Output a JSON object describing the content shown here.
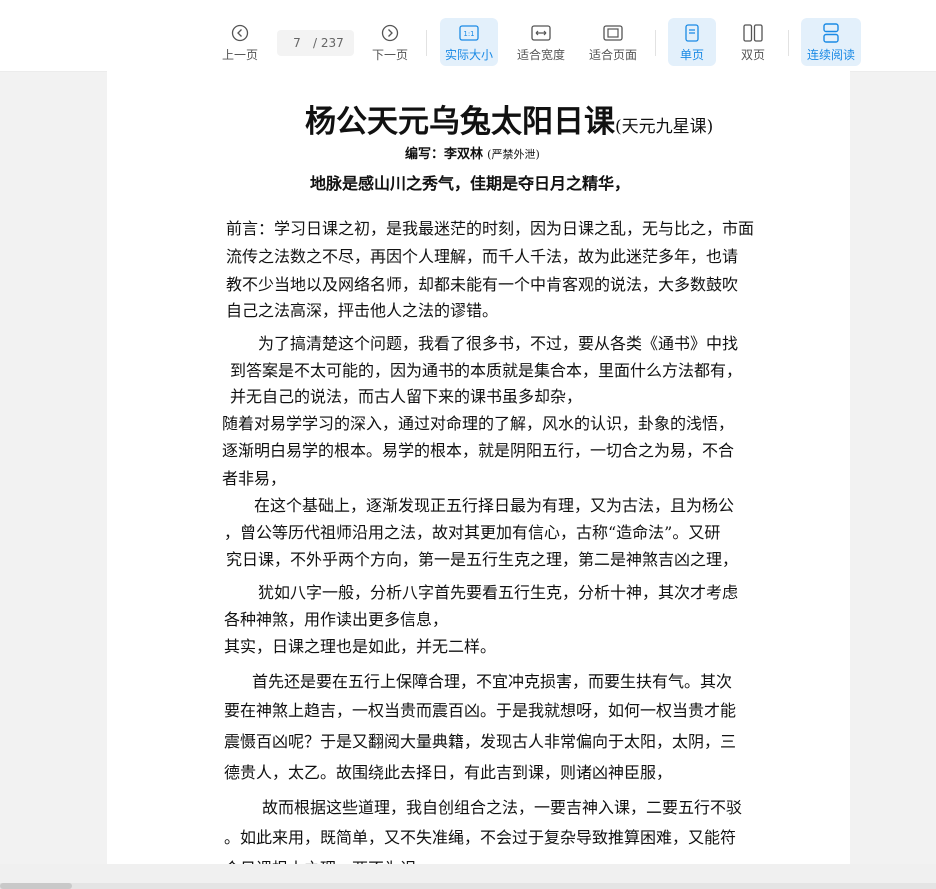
{
  "toolbar": {
    "prev_label": "上一页",
    "current_page": "7",
    "total_pages": "/ 237",
    "next_label": "下一页",
    "actual_size_label": "实际大小",
    "fit_width_label": "适合宽度",
    "fit_page_label": "适合页面",
    "single_page_label": "单页",
    "double_page_label": "双页",
    "continuous_label": "连续阅读",
    "actual_size_icon_text": "1:1",
    "accent_color": "#1a8ae5"
  },
  "document": {
    "title": "杨公天元乌兔太阳日课",
    "title_sub": "(天元九星课)",
    "author_prefix": "编写：",
    "author_name": "李双林",
    "author_note": "(严禁外泄)",
    "motto": "地脉是感山川之秀气，佳期是夺日月之精华，",
    "lines": [
      "前言：学习日课之初，是我最迷茫的时刻，因为日课之乱，无与比之，市面",
      "流传之法数之不尽，再因个人理解，而千人千法，故为此迷茫多年，也请",
      "教不少当地以及网络名师，却都未能有一个中肯客观的说法，大多数鼓吹",
      "自己之法高深，抨击他人之法的谬错。",
      "为了搞清楚这个问题，我看了很多书，不过，要从各类《通书》中找",
      "到答案是不太可能的，因为通书的本质就是集合本，里面什么方法都有，",
      "并无自己的说法，而古人留下来的课书虽多却杂，",
      "随着对易学学习的深入，通过对命理的了解，风水的认识，卦象的浅悟，",
      "逐渐明白易学的根本。易学的根本，就是阴阳五行，一切合之为易，不合",
      "者非易，",
      "在这个基础上，逐渐发现正五行择日最为有理，又为古法，且为杨公",
      "，曾公等历代祖师沿用之法，故对其更加有信心，古称“造命法”。又研",
      "究日课，不外乎两个方向，第一是五行生克之理，第二是神煞吉凶之理，",
      "犹如八字一般，分析八字首先要看五行生克，分析十神，其次才考虑",
      "各种神煞，用作读出更多信息，",
      "其实，日课之理也是如此，并无二样。",
      "首先还是要在五行上保障合理，不宜冲克损害，而要生扶有气。其次",
      "要在神煞上趋吉，一权当贵而震百凶。于是我就想呀，如何一权当贵才能",
      "震慑百凶呢？于是又翻阅大量典籍，发现古人非常偏向于太阳，太阴，三",
      "德贵人，太乙。故围绕此去择日，有此吉到课，则诸凶神臣服，",
      "故而根据这些道理，我自创组合之法，一要吉神入课，二要五行不驳",
      "。如此来用，既简单，又不失准绳，不会过于复杂导致推算困难，又能符",
      "合日课根本之理，两不为误。"
    ]
  }
}
